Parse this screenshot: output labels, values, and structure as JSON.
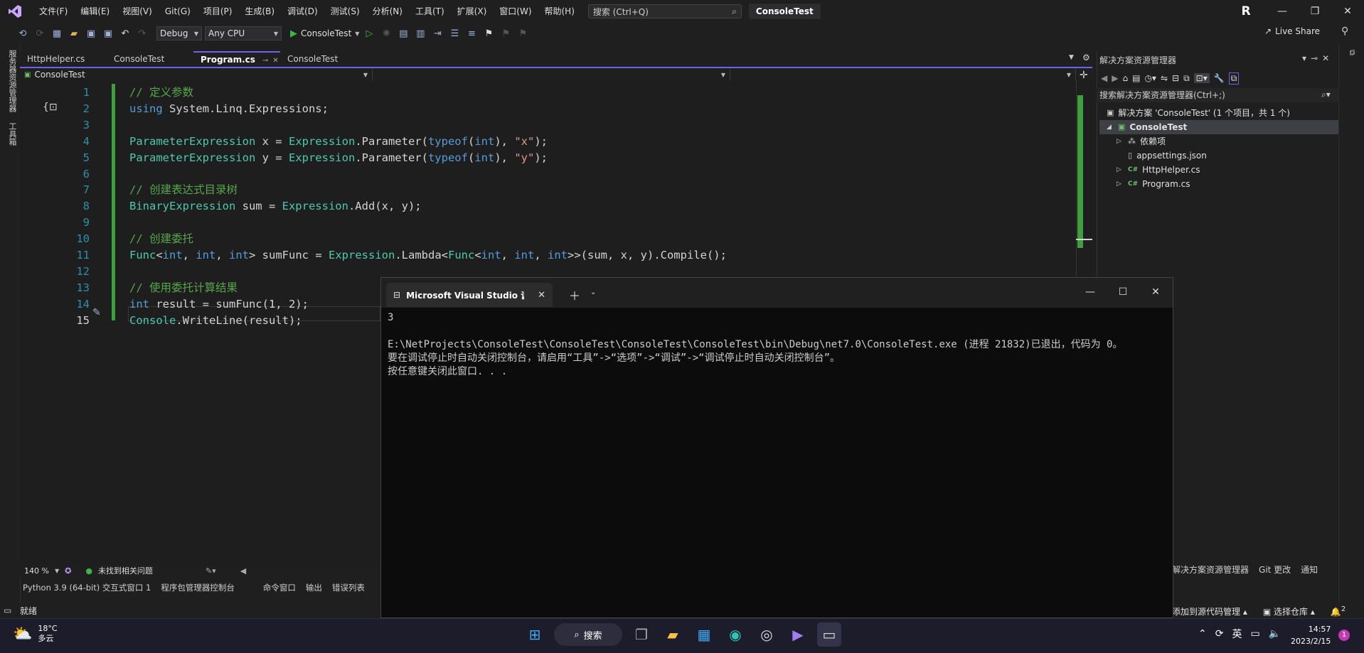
{
  "menu": {
    "items": [
      "文件(F)",
      "编辑(E)",
      "视图(V)",
      "Git(G)",
      "项目(P)",
      "生成(B)",
      "调试(D)",
      "测试(S)",
      "分析(N)",
      "工具(T)",
      "扩展(X)",
      "窗口(W)",
      "帮助(H)"
    ],
    "search_placeholder": "搜索 (Ctrl+Q)",
    "solution_name": "ConsoleTest",
    "user_initial": "R"
  },
  "toolbar": {
    "config": "Debug",
    "platform": "Any CPU",
    "start_target": "ConsoleTest",
    "live_share": "Live Share"
  },
  "left_rail": {
    "server_explorer": "服务器资源管理器",
    "toolbox": "工具箱"
  },
  "tabs": [
    {
      "label": "HttpHelper.cs"
    },
    {
      "label": "ConsoleTest"
    },
    {
      "label": "Program.cs",
      "active": true
    },
    {
      "label": "ConsoleTest"
    }
  ],
  "navbar": {
    "project": "ConsoleTest"
  },
  "editor": {
    "lines": [
      {
        "n": "1",
        "tokens": [
          [
            "cm",
            "// 定义参数"
          ]
        ]
      },
      {
        "n": "2",
        "tokens": [
          [
            "kw",
            "using"
          ],
          [
            "tx",
            " System.Linq.Expressions;"
          ]
        ]
      },
      {
        "n": "3",
        "tokens": []
      },
      {
        "n": "4",
        "tokens": [
          [
            "ty",
            "ParameterExpression"
          ],
          [
            "tx",
            " x = "
          ],
          [
            "ty",
            "Expression"
          ],
          [
            "tx",
            ".Parameter("
          ],
          [
            "kw",
            "typeof"
          ],
          [
            "tx",
            "("
          ],
          [
            "kw",
            "int"
          ],
          [
            "tx",
            "), "
          ],
          [
            "st",
            "\"x\""
          ],
          [
            "tx",
            ");"
          ]
        ]
      },
      {
        "n": "5",
        "tokens": [
          [
            "ty",
            "ParameterExpression"
          ],
          [
            "tx",
            " y = "
          ],
          [
            "ty",
            "Expression"
          ],
          [
            "tx",
            ".Parameter("
          ],
          [
            "kw",
            "typeof"
          ],
          [
            "tx",
            "("
          ],
          [
            "kw",
            "int"
          ],
          [
            "tx",
            "), "
          ],
          [
            "st",
            "\"y\""
          ],
          [
            "tx",
            ");"
          ]
        ]
      },
      {
        "n": "6",
        "tokens": []
      },
      {
        "n": "7",
        "tokens": [
          [
            "cm",
            "// 创建表达式目录树"
          ]
        ]
      },
      {
        "n": "8",
        "tokens": [
          [
            "ty",
            "BinaryExpression"
          ],
          [
            "tx",
            " sum = "
          ],
          [
            "ty",
            "Expression"
          ],
          [
            "tx",
            ".Add(x, y);"
          ]
        ]
      },
      {
        "n": "9",
        "tokens": []
      },
      {
        "n": "10",
        "tokens": [
          [
            "cm",
            "// 创建委托"
          ]
        ]
      },
      {
        "n": "11",
        "tokens": [
          [
            "ty",
            "Func"
          ],
          [
            "tx",
            "<"
          ],
          [
            "kw",
            "int"
          ],
          [
            "tx",
            ", "
          ],
          [
            "kw",
            "int"
          ],
          [
            "tx",
            ", "
          ],
          [
            "kw",
            "int"
          ],
          [
            "tx",
            "> sumFunc = "
          ],
          [
            "ty",
            "Expression"
          ],
          [
            "tx",
            ".Lambda<"
          ],
          [
            "ty",
            "Func"
          ],
          [
            "tx",
            "<"
          ],
          [
            "kw",
            "int"
          ],
          [
            "tx",
            ", "
          ],
          [
            "kw",
            "int"
          ],
          [
            "tx",
            ", "
          ],
          [
            "kw",
            "int"
          ],
          [
            "tx",
            ">>(sum, x, y).Compile();"
          ]
        ]
      },
      {
        "n": "12",
        "tokens": []
      },
      {
        "n": "13",
        "tokens": [
          [
            "cm",
            "// 使用委托计算结果"
          ]
        ]
      },
      {
        "n": "14",
        "tokens": [
          [
            "kw",
            "int"
          ],
          [
            "tx",
            " result = sumFunc(1, 2);"
          ]
        ]
      },
      {
        "n": "15",
        "tokens": [
          [
            "ty",
            "Console"
          ],
          [
            "tx",
            ".WriteLine(result);"
          ]
        ]
      }
    ],
    "zoom": "140 %",
    "issues": "未找到相关问题"
  },
  "bottom_tabs": [
    "Python 3.9 (64-bit) 交互式窗口 1",
    "程序包管理器控制台",
    "命令窗口",
    "输出",
    "错误列表"
  ],
  "solution_explorer": {
    "title": "解决方案资源管理器",
    "search_placeholder": "搜索解决方案资源管理器(Ctrl+;)",
    "solution_label": "解决方案 'ConsoleTest' (1 个项目，共 1 个)",
    "project": "ConsoleTest",
    "items": [
      "依赖项",
      "appsettings.json",
      "HttpHelper.cs",
      "Program.cs"
    ],
    "bottom_tabs": [
      "解决方案资源管理器",
      "Git 更改",
      "通知"
    ]
  },
  "statusbar": {
    "ready": "就绪",
    "add_source_control": "添加到源代码管理",
    "select_repo": "选择仓库",
    "notifications": "2"
  },
  "console": {
    "title": "Microsoft Visual Studio 调试控制台",
    "output": "3\n\nE:\\NetProjects\\ConsoleTest\\ConsoleTest\\ConsoleTest\\ConsoleTest\\bin\\Debug\\net7.0\\ConsoleTest.exe (进程 21832)已退出，代码为 0。\n要在调试停止时自动关闭控制台，请启用“工具”->“选项”->“调试”->“调试停止时自动关闭控制台”。\n按任意键关闭此窗口. . ."
  },
  "taskbar": {
    "temperature": "18°C",
    "weather": "多云",
    "search_label": "搜索",
    "ime": "英",
    "time": "14:57",
    "date": "2023/2/15",
    "badge": "1"
  },
  "colors": {
    "accent": "#7160e8",
    "change_bar": "#3e9e3e",
    "comment": "#57a64a",
    "keyword": "#569cd6",
    "type": "#4ec9b0",
    "string": "#d69d85"
  }
}
